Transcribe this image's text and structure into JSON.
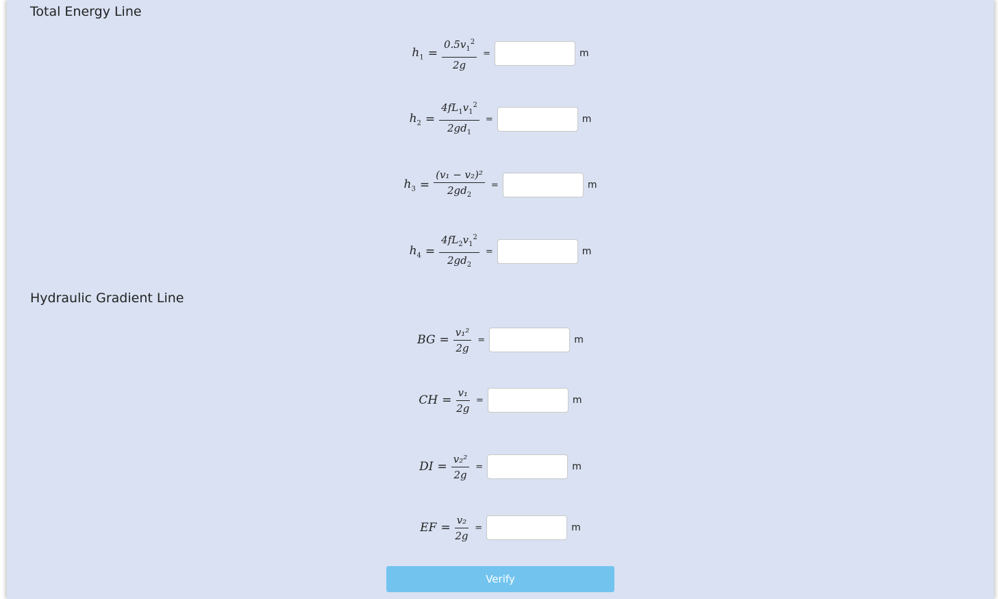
{
  "sections": {
    "tel_title": "Total Energy Line",
    "hgl_title": "Hydraulic Gradient Line"
  },
  "equals": "=",
  "unit": "m",
  "verify_label": "Verify",
  "tel": [
    {
      "lhs": "h",
      "lhs_sub": "1",
      "num": "0.5v",
      "num_sub": "1",
      "num_sup": "2",
      "den": "2g",
      "den_sub": ""
    },
    {
      "lhs": "h",
      "lhs_sub": "2",
      "num": "4fL",
      "num_sub": "1",
      "num_tail": "v",
      "num_tail_sub": "1",
      "num_sup": "2",
      "den": "2gd",
      "den_sub": "1"
    },
    {
      "lhs": "h",
      "lhs_sub": "3",
      "num": "(v₁ − v₂)²",
      "den": "2gd",
      "den_sub": "2"
    },
    {
      "lhs": "h",
      "lhs_sub": "4",
      "num": "4fL",
      "num_sub": "2",
      "num_tail": "v",
      "num_tail_sub": "1",
      "num_sup": "2",
      "den": "2gd",
      "den_sub": "2"
    }
  ],
  "hgl": [
    {
      "lhs": "BG",
      "num": "v₁²",
      "den": "2g"
    },
    {
      "lhs": "CH",
      "num": "v₁",
      "den": "2g"
    },
    {
      "lhs": "DI",
      "num": "v₂²",
      "den": "2g"
    },
    {
      "lhs": "EF",
      "num": "v₂",
      "den": "2g"
    }
  ]
}
